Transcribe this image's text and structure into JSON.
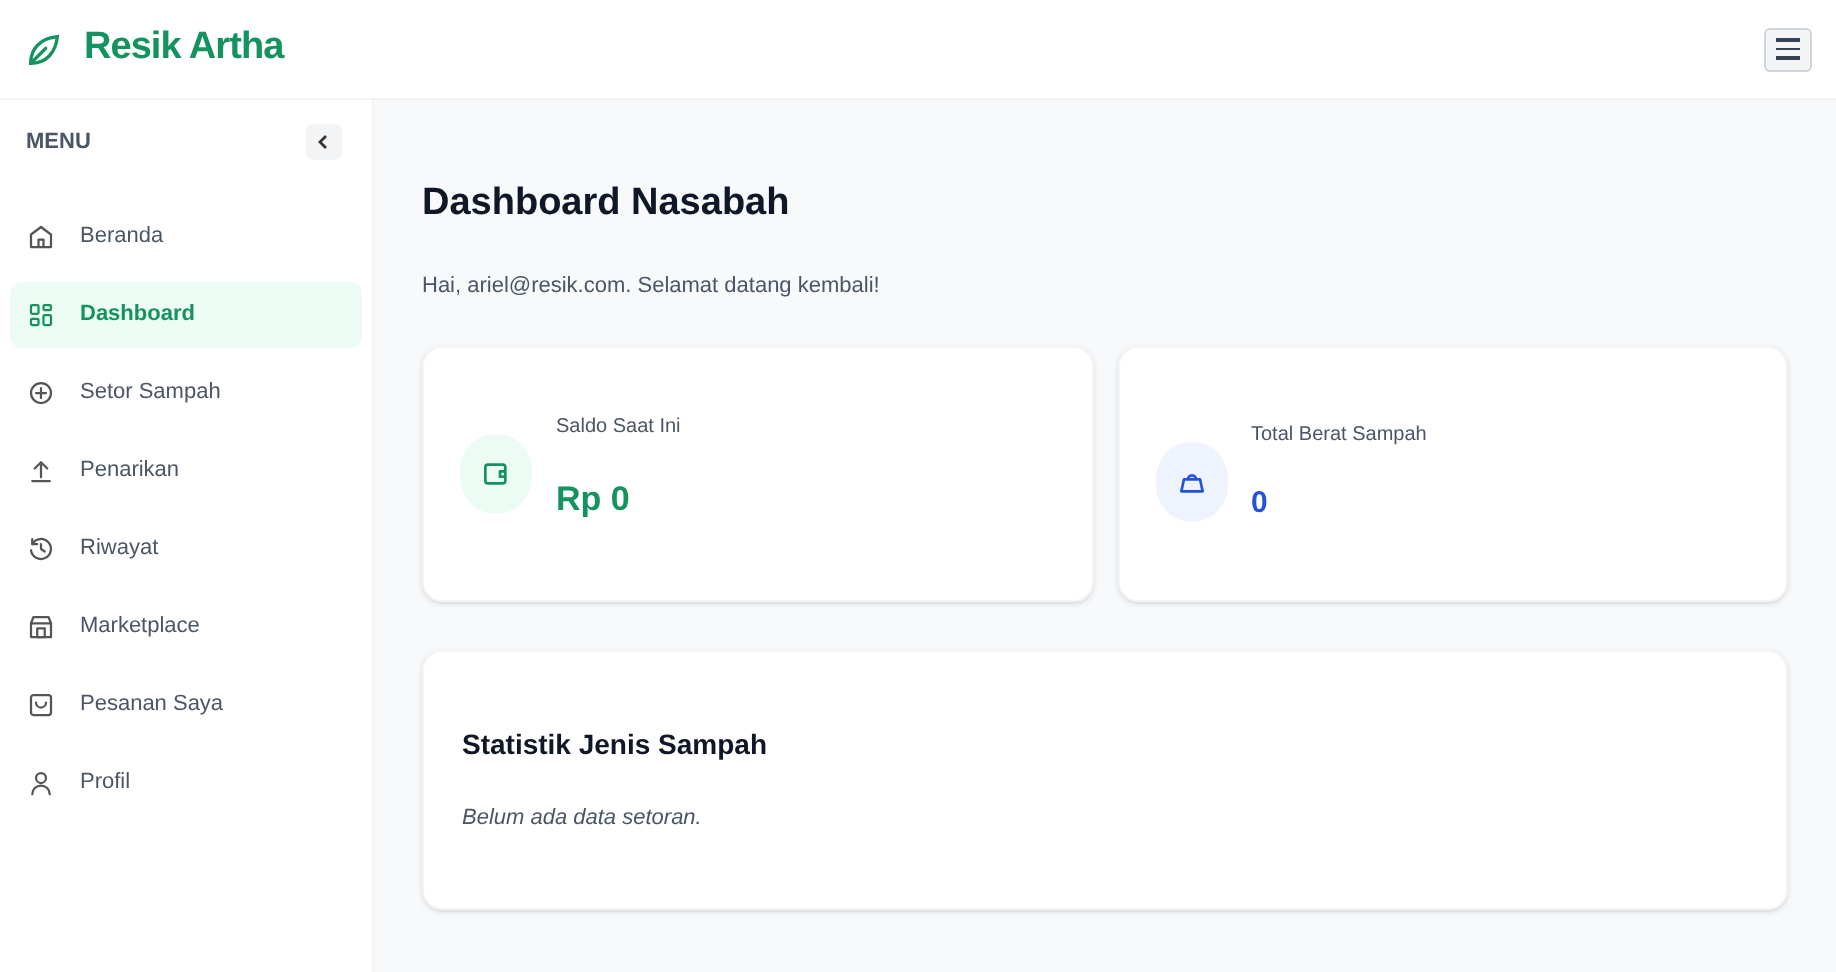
{
  "brand": "Resik Artha",
  "sidebar": {
    "heading": "MENU",
    "items": [
      {
        "label": "Beranda",
        "kind": "home",
        "selected": false
      },
      {
        "label": "Dashboard",
        "kind": "grid",
        "selected": true
      },
      {
        "label": "Setor Sampah",
        "kind": "plus",
        "selected": false
      },
      {
        "label": "Penarikan",
        "kind": "upload",
        "selected": false
      },
      {
        "label": "Riwayat",
        "kind": "history",
        "selected": false
      },
      {
        "label": "Marketplace",
        "kind": "store",
        "selected": false
      },
      {
        "label": "Pesanan Saya",
        "kind": "bag",
        "selected": false
      },
      {
        "label": "Profil",
        "kind": "user",
        "selected": false
      }
    ]
  },
  "page_title": "Dashboard Nasabah",
  "greeting": "Hai, ariel@resik.com. Selamat datang kembali!",
  "stats": [
    {
      "kind": "balance",
      "label": "Saldo Saat Ini",
      "value": "Rp 0"
    },
    {
      "kind": "weight",
      "label": "Total Berat Sampah",
      "value": "0"
    }
  ],
  "waste_stats": {
    "title": "Statistik Jenis Sampah",
    "empty_message": "Belum ada data setoran."
  }
}
